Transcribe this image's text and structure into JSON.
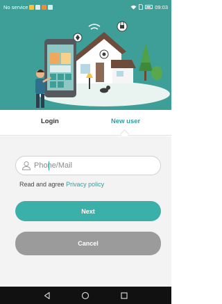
{
  "status_bar": {
    "carrier": "No service",
    "time": "09:03"
  },
  "tabs": {
    "login": "Login",
    "new_user": "New user"
  },
  "form": {
    "phone_placeholder": "Phone/Mail",
    "agree_text": "Read and agree ",
    "privacy_link": "Privacy policy",
    "next_label": "Next",
    "cancel_label": "Cancel"
  },
  "colors": {
    "accent": "#3bb0a8",
    "header_bg": "#3d9f98",
    "link": "#2f9fa0",
    "cancel": "#9b9b9b"
  },
  "icons": {
    "input": "user-icon",
    "nav": [
      "back-icon",
      "home-icon",
      "recents-icon"
    ]
  }
}
